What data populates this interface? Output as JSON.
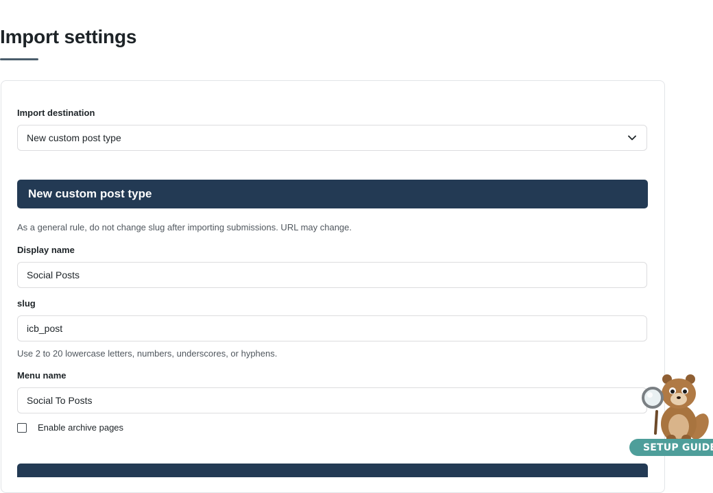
{
  "page": {
    "title": "Import settings"
  },
  "import_destination": {
    "label": "Import destination",
    "selected": "New custom post type"
  },
  "section": {
    "title": "New custom post type",
    "note": "As a general rule, do not change slug after importing submissions. URL may change."
  },
  "fields": {
    "display_name": {
      "label": "Display name",
      "value": "Social Posts"
    },
    "slug": {
      "label": "slug",
      "value": "icb_post",
      "help": "Use 2 to 20 lowercase letters, numbers, underscores, or hyphens."
    },
    "menu_name": {
      "label": "Menu name",
      "value": "Social To Posts"
    }
  },
  "archive": {
    "label": "Enable archive pages",
    "checked": false
  },
  "setup_guide": {
    "label": "SETUP GUIDE M"
  },
  "colors": {
    "header_bg": "#233a54",
    "badge_bg": "#4e9e9a"
  }
}
